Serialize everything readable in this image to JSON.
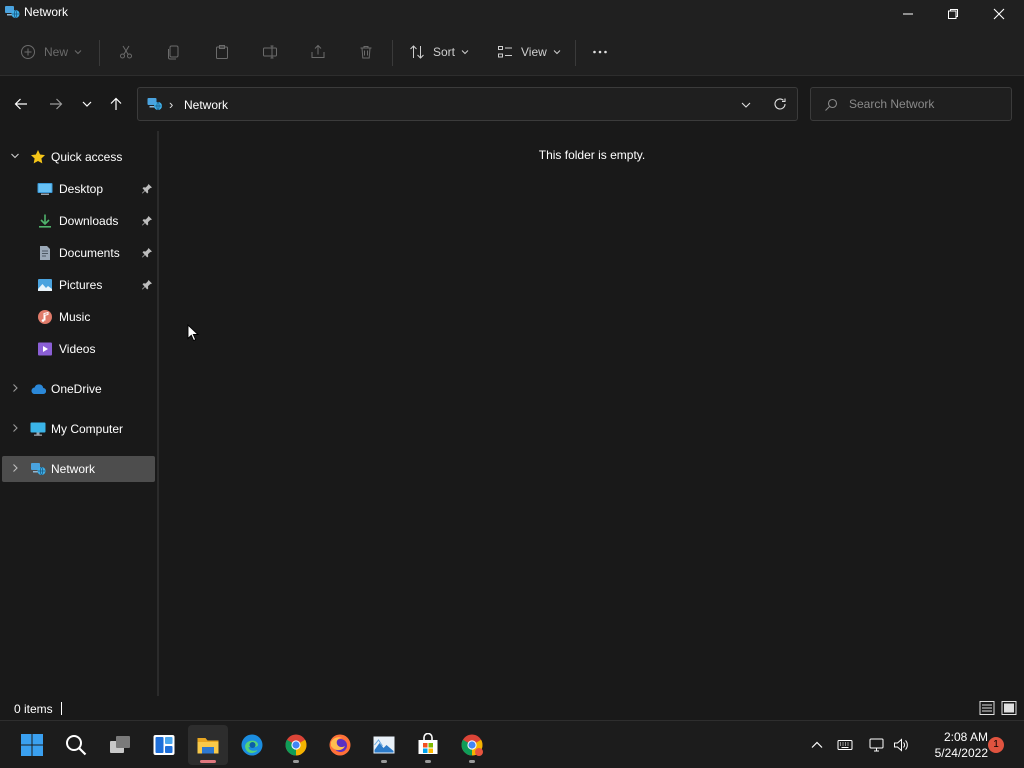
{
  "window": {
    "title": "Network"
  },
  "toolbar": {
    "new_label": "New",
    "sort_label": "Sort",
    "view_label": "View"
  },
  "address": {
    "crumb": "Network",
    "search_placeholder": "Search Network"
  },
  "sidebar": {
    "items": [
      {
        "label": "Quick access",
        "icon": "star-icon"
      },
      {
        "label": "Desktop",
        "icon": "desktop-icon",
        "pinned": true
      },
      {
        "label": "Downloads",
        "icon": "download-icon",
        "pinned": true
      },
      {
        "label": "Documents",
        "icon": "document-icon",
        "pinned": true
      },
      {
        "label": "Pictures",
        "icon": "pictures-icon",
        "pinned": true
      },
      {
        "label": "Music",
        "icon": "music-icon"
      },
      {
        "label": "Videos",
        "icon": "videos-icon"
      },
      {
        "label": "OneDrive",
        "icon": "cloud-icon"
      },
      {
        "label": "My Computer",
        "icon": "computer-icon"
      },
      {
        "label": "Network",
        "icon": "network-icon",
        "selected": true
      }
    ]
  },
  "content": {
    "empty_message": "This folder is empty."
  },
  "status": {
    "item_count": "0 items"
  },
  "taskbar": {
    "apps": [
      "start",
      "search",
      "task-view",
      "widgets",
      "file-explorer",
      "edge",
      "chrome",
      "firefox",
      "photos",
      "store",
      "chrome-profile"
    ],
    "time": "2:08 AM",
    "date": "5/24/2022",
    "notification_count": "1"
  },
  "colors": {
    "background": "#191919",
    "chrome": "#202020",
    "selected": "#4d4d4d",
    "accent": "#0078d4"
  }
}
